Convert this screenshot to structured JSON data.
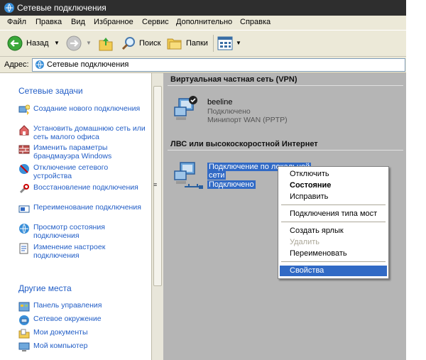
{
  "window": {
    "title": "Сетевые подключения"
  },
  "menu": [
    "Файл",
    "Правка",
    "Вид",
    "Избранное",
    "Сервис",
    "Дополнительно",
    "Справка"
  ],
  "toolbar": {
    "back": "Назад",
    "search": "Поиск",
    "folders": "Папки"
  },
  "address": {
    "label": "Адрес:",
    "value": "Сетевые подключения"
  },
  "left": {
    "tasks_title": "Сетевые задачи",
    "tasks": [
      {
        "icon": "new-connection-icon",
        "text": "Создание нового подключения"
      },
      {
        "icon": "home-network-icon",
        "text": "Установить домашнюю сеть или сеть малого офиса"
      },
      {
        "icon": "firewall-icon",
        "text": "Изменить параметры брандмауэра Windows"
      },
      {
        "icon": "disable-device-icon",
        "text": "Отключение сетевого устройства"
      },
      {
        "icon": "repair-icon",
        "text": "Восстановление подключения"
      },
      {
        "icon": "rename-icon",
        "text": "Переименование подключения"
      },
      {
        "icon": "status-icon",
        "text": "Просмотр состояния подключения"
      },
      {
        "icon": "settings-icon",
        "text": "Изменение настроек подключения"
      }
    ],
    "places_title": "Другие места",
    "places": [
      {
        "icon": "control-panel-icon",
        "text": "Панель управления"
      },
      {
        "icon": "network-places-icon",
        "text": "Сетевое окружение"
      },
      {
        "icon": "my-documents-icon",
        "text": "Мои документы"
      },
      {
        "icon": "my-computer-icon",
        "text": "Мой компьютер"
      }
    ]
  },
  "right": {
    "vpn_group": "Виртуальная частная сеть (VPN)",
    "vpn_conn": {
      "name": "beeline",
      "status": "Подключено",
      "device": "Минипорт WAN (PPTP)"
    },
    "lan_group": "ЛВС или высокоскоростной Интернет",
    "lan_conn": {
      "name_line1": "Подключение по локальной",
      "name_line2": "сети",
      "status": "Подключено"
    }
  },
  "context_menu": {
    "disconnect": "Отключить",
    "status": "Состояние",
    "repair": "Исправить",
    "bridge": "Подключения типа мост",
    "shortcut": "Создать ярлык",
    "delete": "Удалить",
    "rename": "Переименовать",
    "properties": "Свойства"
  },
  "colors": {
    "link": "#215dc6",
    "selection": "#316ac5",
    "pane": "#b5b5b5"
  }
}
